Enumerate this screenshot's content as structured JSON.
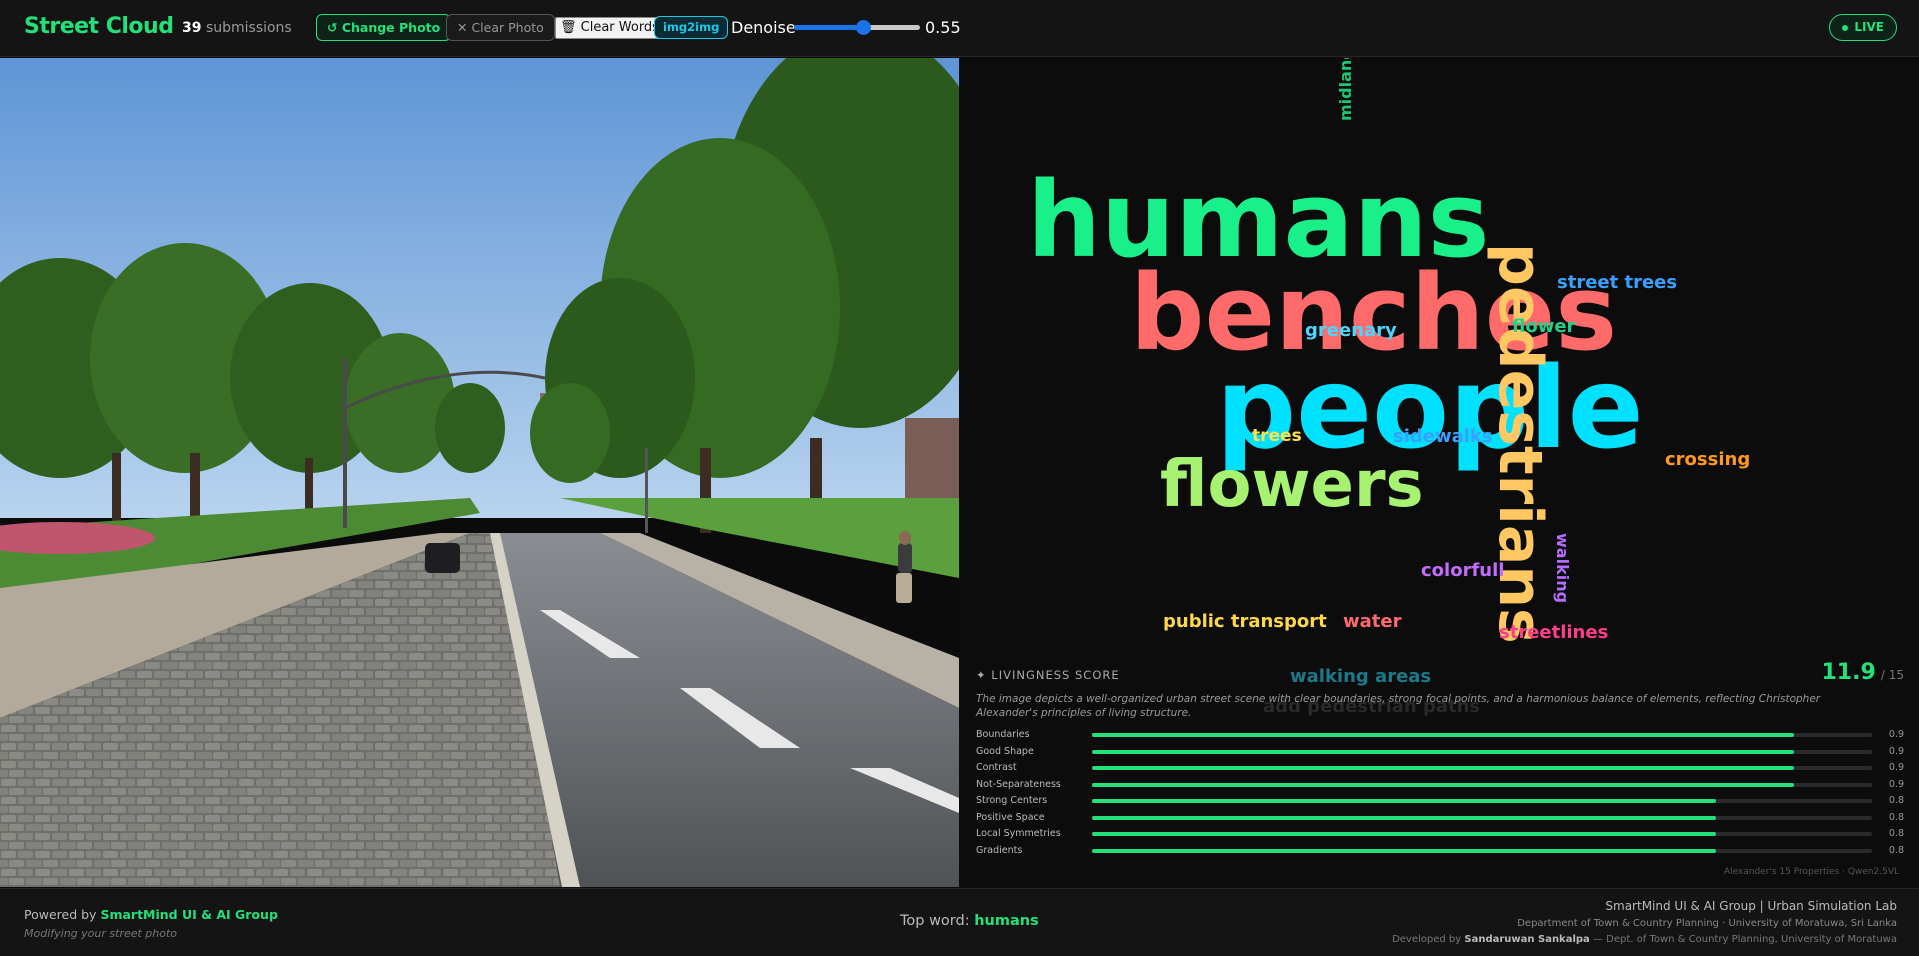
{
  "header": {
    "brand": "Street Cloud",
    "submissions_count": "39",
    "submissions_label": "submissions",
    "change_photo": "↺ Change Photo",
    "clear_photo": "✕ Clear Photo",
    "clear_words": "🗑 Clear Words",
    "img2img": "img2img",
    "denoise_label": "Denoise",
    "denoise_value": "0.55",
    "denoise_fraction": 0.55,
    "live": "LIVE"
  },
  "photo": {
    "description_icon": "street-photo"
  },
  "cloud": {
    "words": [
      {
        "text": "humans",
        "color": "#19f08a"
      },
      {
        "text": "benches",
        "color": "#ff6b6b"
      },
      {
        "text": "people",
        "color": "#00e0ff"
      },
      {
        "text": "pedestrians",
        "color": "#ffc862"
      },
      {
        "text": "flowers",
        "color": "#a8f272"
      },
      {
        "text": "midlanes",
        "color": "#19c870"
      },
      {
        "text": "street trees",
        "color": "#3aa0ff"
      },
      {
        "text": "greenary",
        "color": "#4ad6ff"
      },
      {
        "text": "flower",
        "color": "#21d18a"
      },
      {
        "text": "trees",
        "color": "#ffe14a"
      },
      {
        "text": "sidewalks",
        "color": "#3aa0ff"
      },
      {
        "text": "crossing",
        "color": "#ff9a1f"
      },
      {
        "text": "colorfull",
        "color": "#c46cff"
      },
      {
        "text": "walking",
        "color": "#b66cff"
      },
      {
        "text": "public transport",
        "color": "#ffd84a"
      },
      {
        "text": "water",
        "color": "#ff6b6b"
      },
      {
        "text": "streetlines",
        "color": "#ff3d8b"
      },
      {
        "text": "walking areas",
        "color": "#1b7a8a"
      },
      {
        "text": "add pedestrian paths",
        "color": "#2a2a2a"
      }
    ]
  },
  "score": {
    "title": "✦ LIVINGNESS SCORE",
    "value": "11.9",
    "max": "/ 15",
    "description": "The image depicts a well-organized urban street scene with clear boundaries, strong focal points, and a harmonious balance of elements, reflecting Christopher Alexander's principles of living structure.",
    "metrics": [
      {
        "label": "Boundaries",
        "value": "0.9",
        "fraction": 0.9
      },
      {
        "label": "Good Shape",
        "value": "0.9",
        "fraction": 0.9
      },
      {
        "label": "Contrast",
        "value": "0.9",
        "fraction": 0.9
      },
      {
        "label": "Not-Separateness",
        "value": "0.9",
        "fraction": 0.9
      },
      {
        "label": "Strong Centers",
        "value": "0.8",
        "fraction": 0.8
      },
      {
        "label": "Positive Space",
        "value": "0.8",
        "fraction": 0.8
      },
      {
        "label": "Local Symmetries",
        "value": "0.8",
        "fraction": 0.8
      },
      {
        "label": "Gradients",
        "value": "0.8",
        "fraction": 0.8
      }
    ],
    "footnote": "Alexander's 15 Properties · Qwen2.5VL"
  },
  "footer": {
    "powered_by": "Powered by",
    "group": "SmartMind UI & AI Group",
    "modifying": "Modifying your street photo",
    "top_word_label": "Top word:",
    "top_word": "humans",
    "credit_line1": "SmartMind UI & AI Group  |  Urban Simulation Lab",
    "credit_line2": "Department of Town & Country Planning · University of Moratuwa, Sri Lanka",
    "credit_developed": "Developed by",
    "credit_name": "Sandaruwan Sankalpa",
    "credit_rest": "— Dept. of Town & Country Planning, University of Moratuwa"
  }
}
